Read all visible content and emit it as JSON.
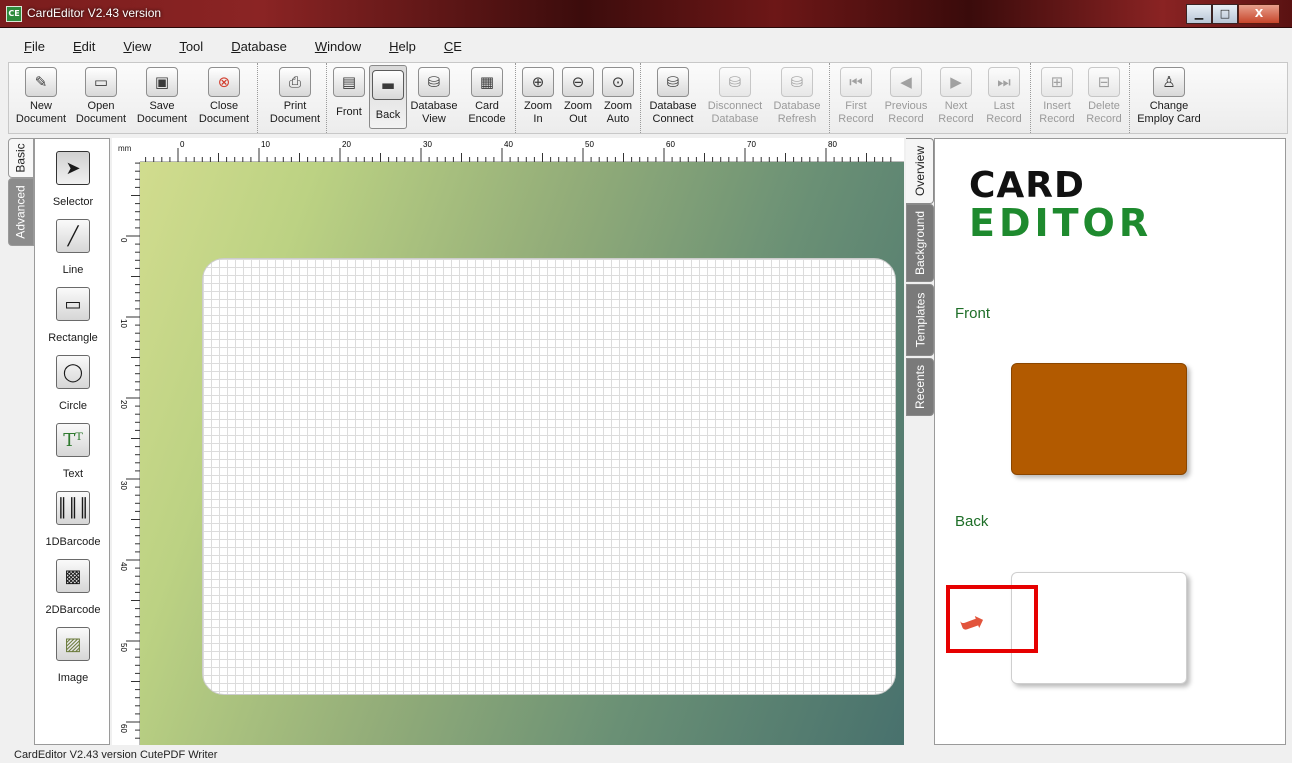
{
  "window": {
    "title": "CardEditor V2.43 version",
    "app_icon": "CE",
    "min": "▁",
    "max": "□",
    "close": "X"
  },
  "menu": [
    {
      "key": "F",
      "rest": "ile"
    },
    {
      "key": "E",
      "rest": "dit"
    },
    {
      "key": "V",
      "rest": "iew"
    },
    {
      "key": "T",
      "rest": "ool"
    },
    {
      "key": "D",
      "rest": "atabase"
    },
    {
      "key": "W",
      "rest": "indow"
    },
    {
      "key": "H",
      "rest": "elp"
    },
    {
      "key": "C",
      "rest": "E"
    }
  ],
  "toolbar": {
    "new": [
      "New",
      "Document"
    ],
    "open": [
      "Open",
      "Document"
    ],
    "save": [
      "Save",
      "Document"
    ],
    "close": [
      "Close",
      "Document"
    ],
    "print": [
      "Print",
      "Document"
    ],
    "front": "Front",
    "back": "Back",
    "dbview": [
      "Database",
      "View"
    ],
    "encode": [
      "Card",
      "Encode"
    ],
    "zoomin": [
      "Zoom",
      "In"
    ],
    "zoomout": [
      "Zoom",
      "Out"
    ],
    "zoomauto": [
      "Zoom",
      "Auto"
    ],
    "dbconnect": [
      "Database",
      "Connect"
    ],
    "dbdisconnect": [
      "Disconnect",
      "Database"
    ],
    "dbrefresh": [
      "Database",
      "Refresh"
    ],
    "first": [
      "First",
      "Record"
    ],
    "previous": [
      "Previous",
      "Record"
    ],
    "next": [
      "Next",
      "Record"
    ],
    "last": [
      "Last",
      "Record"
    ],
    "insert": [
      "Insert",
      "Record"
    ],
    "delete": [
      "Delete",
      "Record"
    ],
    "change": [
      "Change",
      "Employ Card"
    ]
  },
  "left_tabs": {
    "basic": "Basic",
    "advanced": "Advanced"
  },
  "tools": [
    "Selector",
    "Line",
    "Rectangle",
    "Circle",
    "Text",
    "1DBarcode",
    "2DBarcode",
    "Image"
  ],
  "ruler": {
    "unit": "mm",
    "h_labels": [
      "0",
      "10",
      "20",
      "30",
      "40",
      "50",
      "60",
      "70",
      "80"
    ],
    "v_labels": [
      "0",
      "10",
      "20",
      "30",
      "40",
      "50",
      "60"
    ]
  },
  "right_tabs": {
    "overview": "Overview",
    "background": "Background",
    "templates": "Templates",
    "recents": "Recents"
  },
  "overview": {
    "logo_line1": "CARD",
    "logo_line2": "EDITOR",
    "front_label": "Front",
    "back_label": "Back",
    "front_color": "#b25a00"
  },
  "status": "CardEditor V2.43 version CutePDF Writer",
  "colors": {
    "highlight": "#e60000",
    "logo_green": "#1e8a2e",
    "arrow": "#e2543c"
  }
}
